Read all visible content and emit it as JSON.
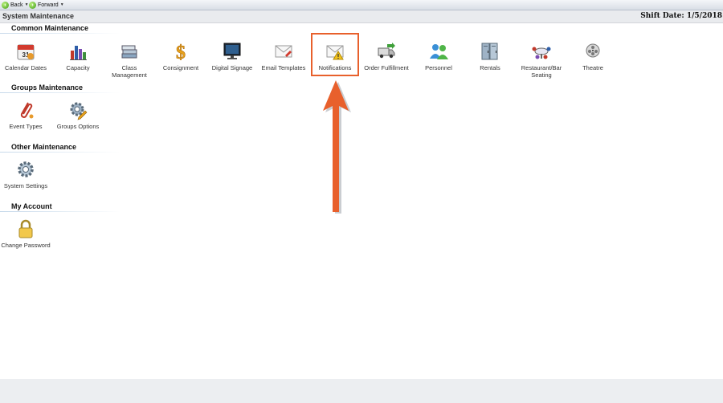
{
  "nav": {
    "back_label": "Back",
    "forward_label": "Forward"
  },
  "header": {
    "title": "System Maintenance",
    "shift_date": "Shift Date: 1/5/2018"
  },
  "sections": {
    "common": {
      "title": "Common Maintenance",
      "items": [
        {
          "label": "Calendar Dates",
          "icon": "calendar-icon"
        },
        {
          "label": "Capacity",
          "icon": "bar-chart-icon"
        },
        {
          "label": "Class Management",
          "icon": "books-icon"
        },
        {
          "label": "Consignment",
          "icon": "dollar-icon"
        },
        {
          "label": "Digital Signage",
          "icon": "monitor-icon"
        },
        {
          "label": "Email Templates",
          "icon": "email-icon"
        },
        {
          "label": "Notifications",
          "icon": "envelope-warning-icon"
        },
        {
          "label": "Order Fulfillment",
          "icon": "truck-icon"
        },
        {
          "label": "Personnel",
          "icon": "people-icon"
        },
        {
          "label": "Rentals",
          "icon": "lockers-icon"
        },
        {
          "label": "Restaurant/Bar Seating",
          "icon": "dining-table-icon"
        },
        {
          "label": "Theatre",
          "icon": "film-reel-icon"
        }
      ]
    },
    "groups": {
      "title": "Groups Maintenance",
      "items": [
        {
          "label": "Event Types",
          "icon": "paperclip-icon"
        },
        {
          "label": "Groups Options",
          "icon": "gear-pencil-icon"
        }
      ]
    },
    "other": {
      "title": "Other Maintenance",
      "items": [
        {
          "label": "System Settings",
          "icon": "gear-icon"
        }
      ]
    },
    "account": {
      "title": "My Account",
      "items": [
        {
          "label": "Change Password",
          "icon": "padlock-icon"
        }
      ]
    }
  },
  "colors": {
    "highlight": "#e8602c",
    "arrow": "#e8602c",
    "section_line": "#c7d9ea"
  }
}
